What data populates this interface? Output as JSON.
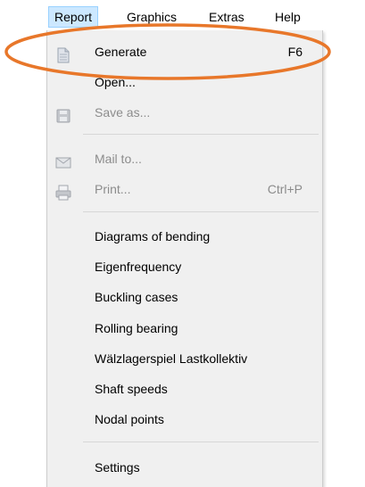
{
  "menubar": {
    "items": [
      {
        "label": "Report"
      },
      {
        "label": "Graphics"
      },
      {
        "label": "Extras"
      },
      {
        "label": "Help"
      }
    ]
  },
  "menu": {
    "generate": {
      "label": "Generate",
      "shortcut": "F6",
      "icon": "document-icon"
    },
    "open": {
      "label": "Open..."
    },
    "save_as": {
      "label": "Save as...",
      "icon": "floppy-disk-icon"
    },
    "mail_to": {
      "label": "Mail to...",
      "icon": "envelope-icon"
    },
    "print": {
      "label": "Print...",
      "shortcut": "Ctrl+P",
      "icon": "printer-icon"
    },
    "diagrams_of_bending": {
      "label": "Diagrams of bending"
    },
    "eigenfrequency": {
      "label": "Eigenfrequency"
    },
    "buckling_cases": {
      "label": "Buckling cases"
    },
    "rolling_bearing": {
      "label": "Rolling bearing"
    },
    "waelzlagerspiel": {
      "label": "Wälzlagerspiel Lastkollektiv"
    },
    "shaft_speeds": {
      "label": "Shaft speeds"
    },
    "nodal_points": {
      "label": "Nodal points"
    },
    "settings": {
      "label": "Settings"
    }
  },
  "colors": {
    "annotation_ellipse": "#e8772a",
    "menu_background": "#f0f0f0",
    "menubar_active": "#cce8ff",
    "disabled_text": "#8c8c8c"
  }
}
